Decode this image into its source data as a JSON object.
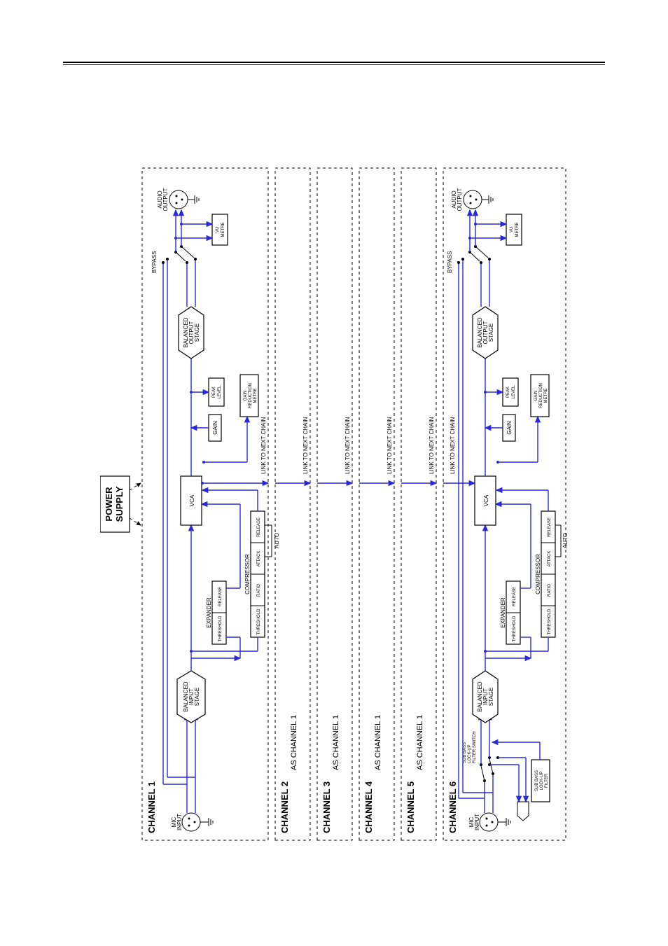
{
  "power_supply": "POWER\nSUPPLY",
  "channels": [
    {
      "title": "CHANNEL 1",
      "sub": ""
    },
    {
      "title": "CHANNEL 2",
      "sub": "AS CHANNEL 1"
    },
    {
      "title": "CHANNEL 3",
      "sub": "AS CHANNEL 1"
    },
    {
      "title": "CHANNEL 4",
      "sub": "AS CHANNEL 1"
    },
    {
      "title": "CHANNEL 5",
      "sub": "AS CHANNEL 1"
    },
    {
      "title": "CHANNEL 6",
      "sub": ""
    }
  ],
  "blocks": {
    "mic_input": "MIC\nINPUT",
    "balanced_input": "BALANCED\nINPUT\nSTAGE",
    "expander": "EXPANDER",
    "exp_threshold": "THRESHOLD",
    "exp_release": "RELEASE",
    "compressor": "COMPRESSOR",
    "cmp_threshold": "THRESHOLD",
    "cmp_ratio": "RATIO",
    "cmp_attack": "ATTACK",
    "cmp_release": "RELEASE",
    "auto": "AUTO",
    "vca": "VCA",
    "gain": "GAIN",
    "peak_level": "PEAK\nLEVEL",
    "gain_reduction": "GAIN\nREDUCTION\nMETRE",
    "balanced_output": "BALANCED\nOUTPUT\nSTAGE",
    "vu_metre": "VU\nMETRE",
    "audio_output": "AUDIO\nOUTPUT",
    "bypass": "BYPASS",
    "link": "LINK TO NEXT CHAIN",
    "sub_bass_sw": "SUB BASS\nLOCK-UP\nFILTER SWITCH",
    "sub_bass_filter": "SUB BASS\nLOCK-UP\nFILTER"
  }
}
